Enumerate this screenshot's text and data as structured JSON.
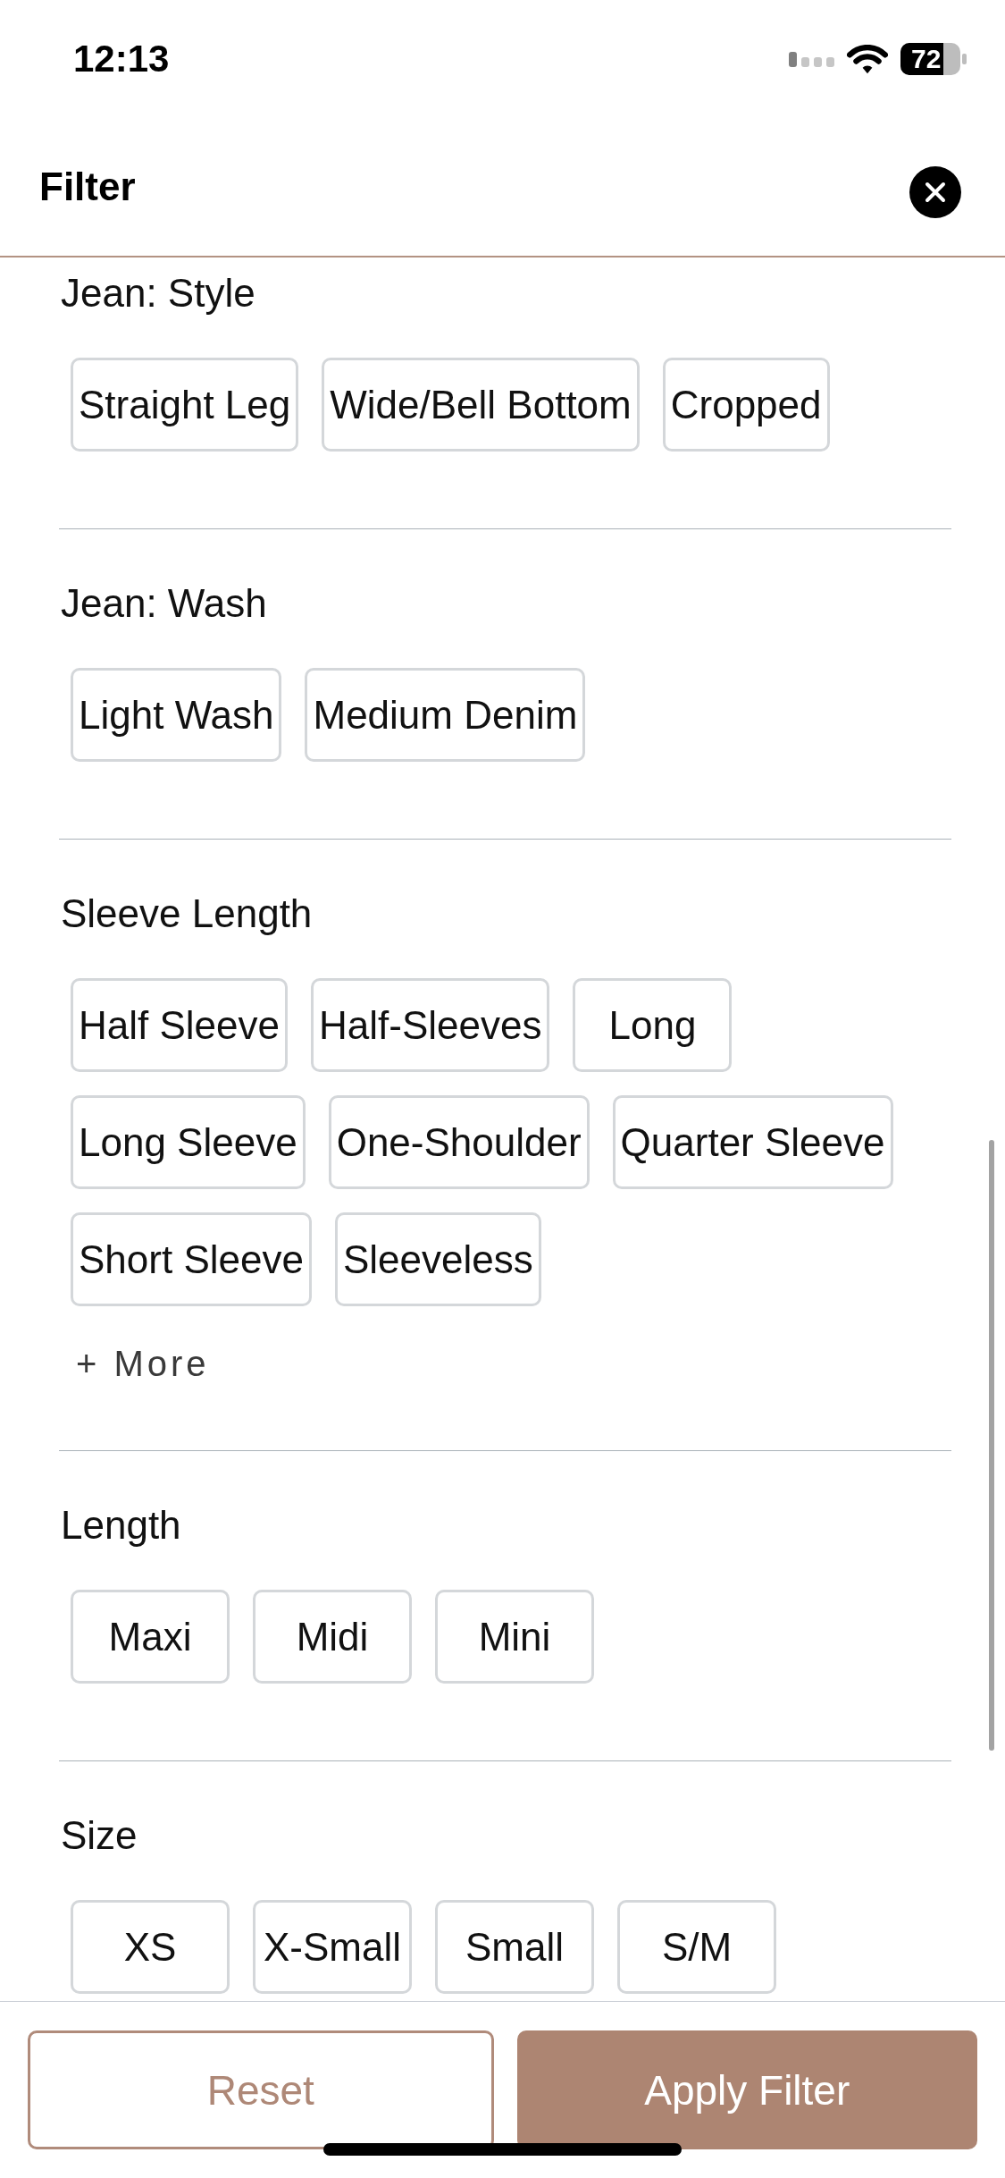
{
  "status_bar": {
    "time": "12:13",
    "battery": "72"
  },
  "header": {
    "title": "Filter"
  },
  "sections": [
    {
      "title": "Jean: Style",
      "options": [
        {
          "label": "Straight Leg",
          "selected": false
        },
        {
          "label": "Wide/Bell Bottom",
          "selected": false
        },
        {
          "label": "Cropped",
          "selected": false
        }
      ]
    },
    {
      "title": "Jean: Wash",
      "options": [
        {
          "label": "Light Wash",
          "selected": false
        },
        {
          "label": "Medium Denim",
          "selected": false
        }
      ]
    },
    {
      "title": "Sleeve Length",
      "options": [
        {
          "label": "Half Sleeve",
          "selected": false
        },
        {
          "label": "Half-Sleeves",
          "selected": false
        },
        {
          "label": "Long",
          "selected": false
        },
        {
          "label": "Long Sleeve",
          "selected": false
        },
        {
          "label": "One-Shoulder",
          "selected": false
        },
        {
          "label": "Quarter Sleeve",
          "selected": false
        },
        {
          "label": "Short Sleeve",
          "selected": false
        },
        {
          "label": "Sleeveless",
          "selected": false
        }
      ],
      "more_link": "+ More"
    },
    {
      "title": "Length",
      "options": [
        {
          "label": "Maxi",
          "selected": false
        },
        {
          "label": "Midi",
          "selected": false
        },
        {
          "label": "Mini",
          "selected": false
        }
      ]
    },
    {
      "title": "Size",
      "options": [
        {
          "label": "XS",
          "selected": false
        },
        {
          "label": "X-Small",
          "selected": false
        },
        {
          "label": "Small",
          "selected": false
        },
        {
          "label": "S/M",
          "selected": false
        }
      ]
    }
  ],
  "footer": {
    "buttons": [
      {
        "label": "Reset",
        "kind": "secondary"
      },
      {
        "label": "Apply Filter",
        "kind": "primary"
      }
    ]
  }
}
